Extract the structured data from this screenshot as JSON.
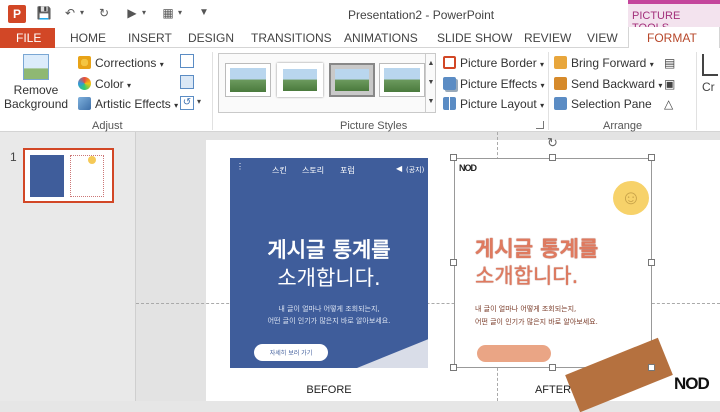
{
  "window": {
    "title": "Presentation2 - PowerPoint",
    "context_tab": "PICTURE TOOLS"
  },
  "tabs": {
    "file": "FILE",
    "home": "HOME",
    "insert": "INSERT",
    "design": "DESIGN",
    "transitions": "TRANSITIONS",
    "animations": "ANIMATIONS",
    "slideshow": "SLIDE SHOW",
    "review": "REVIEW",
    "view": "VIEW",
    "format": "FORMAT"
  },
  "ribbon": {
    "remove_bg": "Remove Background",
    "corrections": "Corrections",
    "color": "Color",
    "artistic": "Artistic Effects",
    "adjust_label": "Adjust",
    "picture_styles_label": "Picture Styles",
    "picture_border": "Picture Border",
    "picture_effects": "Picture Effects",
    "picture_layout": "Picture Layout",
    "bring_forward": "Bring Forward",
    "send_backward": "Send Backward",
    "selection_pane": "Selection Pane",
    "arrange_label": "Arrange",
    "crop_cut": "Cr"
  },
  "slides": {
    "number": "1"
  },
  "before": {
    "nav": [
      "스킨",
      "스토리",
      "포럼"
    ],
    "nav_right": "(공지)",
    "headline1": "게시글 통계를",
    "headline2": "소개합니다.",
    "sub1": "내 글이 얼마나 어떻게 조회되는지,",
    "sub2": "어떤 글이 인기가 많은지 바로 알아보세요.",
    "button": "자세히 보러 가기",
    "caption": "BEFORE"
  },
  "after": {
    "brand": "NOD",
    "headline1": "게시글 통계를",
    "headline2": "소개합니다.",
    "sub1": "내 글이 얼마나 어떻게 조회되는지,",
    "sub2": "어떤 글이 인기가 많은지 바로 알아보세요.",
    "caption": "AFTER"
  },
  "watermark": "NOD",
  "colors": {
    "file_tab": "#d24726",
    "accent": "#b7472a",
    "picture_tools": "#c4469c",
    "before_bg": "#3f5d9b"
  }
}
